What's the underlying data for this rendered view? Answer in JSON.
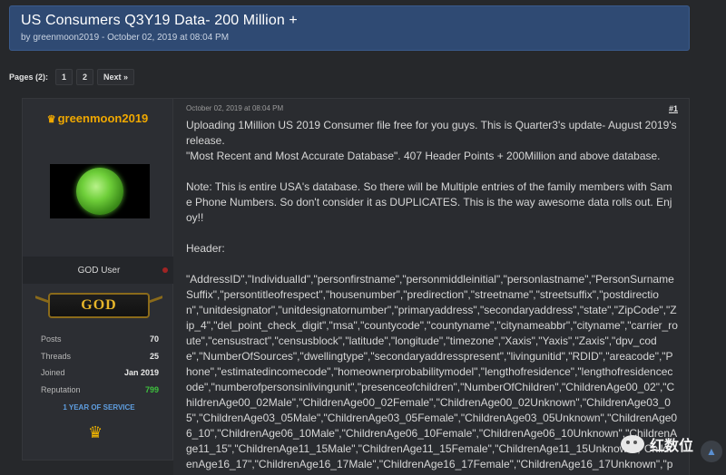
{
  "thread": {
    "title": "US Consumers Q3Y19 Data- 200 Million +",
    "meta_prefix": "by ",
    "author": "greenmoon2019",
    "meta_suffix": " - October 02, 2019 at 08:04 PM"
  },
  "pagination": {
    "label": "Pages (2):",
    "pages": [
      "1",
      "2"
    ],
    "next": "Next »"
  },
  "post": {
    "date": "October 02, 2019 at 08:04 PM",
    "number": "#1",
    "body": "Uploading 1Million US 2019 Consumer file free for you guys. This is Quarter3's update- August 2019's release.\n\"Most Recent and Most Accurate Database\". 407 Header Points + 200Million and above database.\n\nNote: This is entire USA's database. So there will be Multiple entries of the family members with Same Phone Numbers. So don't consider it as DUPLICATES. This is the way awesome data rolls out. Enjoy!!\n\nHeader:\n\n\"AddressID\",\"IndividualId\",\"personfirstname\",\"personmiddleinitial\",\"personlastname\",\"PersonSurnameSuffix\",\"persontitleofrespect\",\"housenumber\",\"predirection\",\"streetname\",\"streetsuffix\",\"postdirection\",\"unitdesignator\",\"unitdesignatornumber\",\"primaryaddress\",\"secondaryaddress\",\"state\",\"ZipCode\",\"Zip_4\",\"del_point_check_digit\",\"msa\",\"countycode\",\"countyname\",\"citynameabbr\",\"cityname\",\"carrier_route\",\"censustract\",\"censusblock\",\"latitude\",\"longitude\",\"timezone\",\"Xaxis\",\"Yaxis\",\"Zaxis\",\"dpv_code\",\"NumberOfSources\",\"dwellingtype\",\"secondaryaddresspresent\",\"livingunitid\",\"RDID\",\"areacode\",\"Phone\",\"estimatedincomecode\",\"homeownerprobabilitymodel\",\"lengthofresidence\",\"lengthofresidencecode\",\"numberofpersonsinlivingunit\",\"presenceofchildren\",\"NumberOfChildren\",\"ChildrenAge00_02\",\"ChildrenAge00_02Male\",\"ChildrenAge00_02Female\",\"ChildrenAge00_02Unknown\",\"ChildrenAge03_05\",\"ChildrenAge03_05Male\",\"ChildrenAge03_05Female\",\"ChildrenAge03_05Unknown\",\"ChildrenAge06_10\",\"ChildrenAge06_10Male\",\"ChildrenAge06_10Female\",\"ChildrenAge06_10Unknown\",\"ChildrenAge11_15\",\"ChildrenAge11_15Male\",\"ChildrenAge11_15Female\",\"ChildrenAge11_15Unknown\",\"ChildrenAge16_17\",\"ChildrenAge16_17Male\",\"ChildrenAge16_17Female\",\"ChildrenAge16_17Unknown\",\"persongender\",\"persondat"
  },
  "user": {
    "name": "greenmoon2019",
    "title": "GOD User",
    "rank": "GOD",
    "stats": [
      {
        "label": "Posts",
        "value": "70"
      },
      {
        "label": "Threads",
        "value": "25"
      },
      {
        "label": "Joined",
        "value": "Jan 2019"
      },
      {
        "label": "Reputation",
        "value": "799"
      }
    ],
    "service": "1 YEAR OF SERVICE"
  },
  "watermark": {
    "text": "红数位"
  },
  "icons": {
    "crown": "crown-icon",
    "status": "status-dot-icon",
    "scroll_top": "chevron-up-icon",
    "wechat": "wechat-icon"
  },
  "colors": {
    "header_bg": "#2f4a73",
    "username": "#f0a800",
    "reputation": "#3ec13e",
    "service": "#5f9ee0"
  }
}
